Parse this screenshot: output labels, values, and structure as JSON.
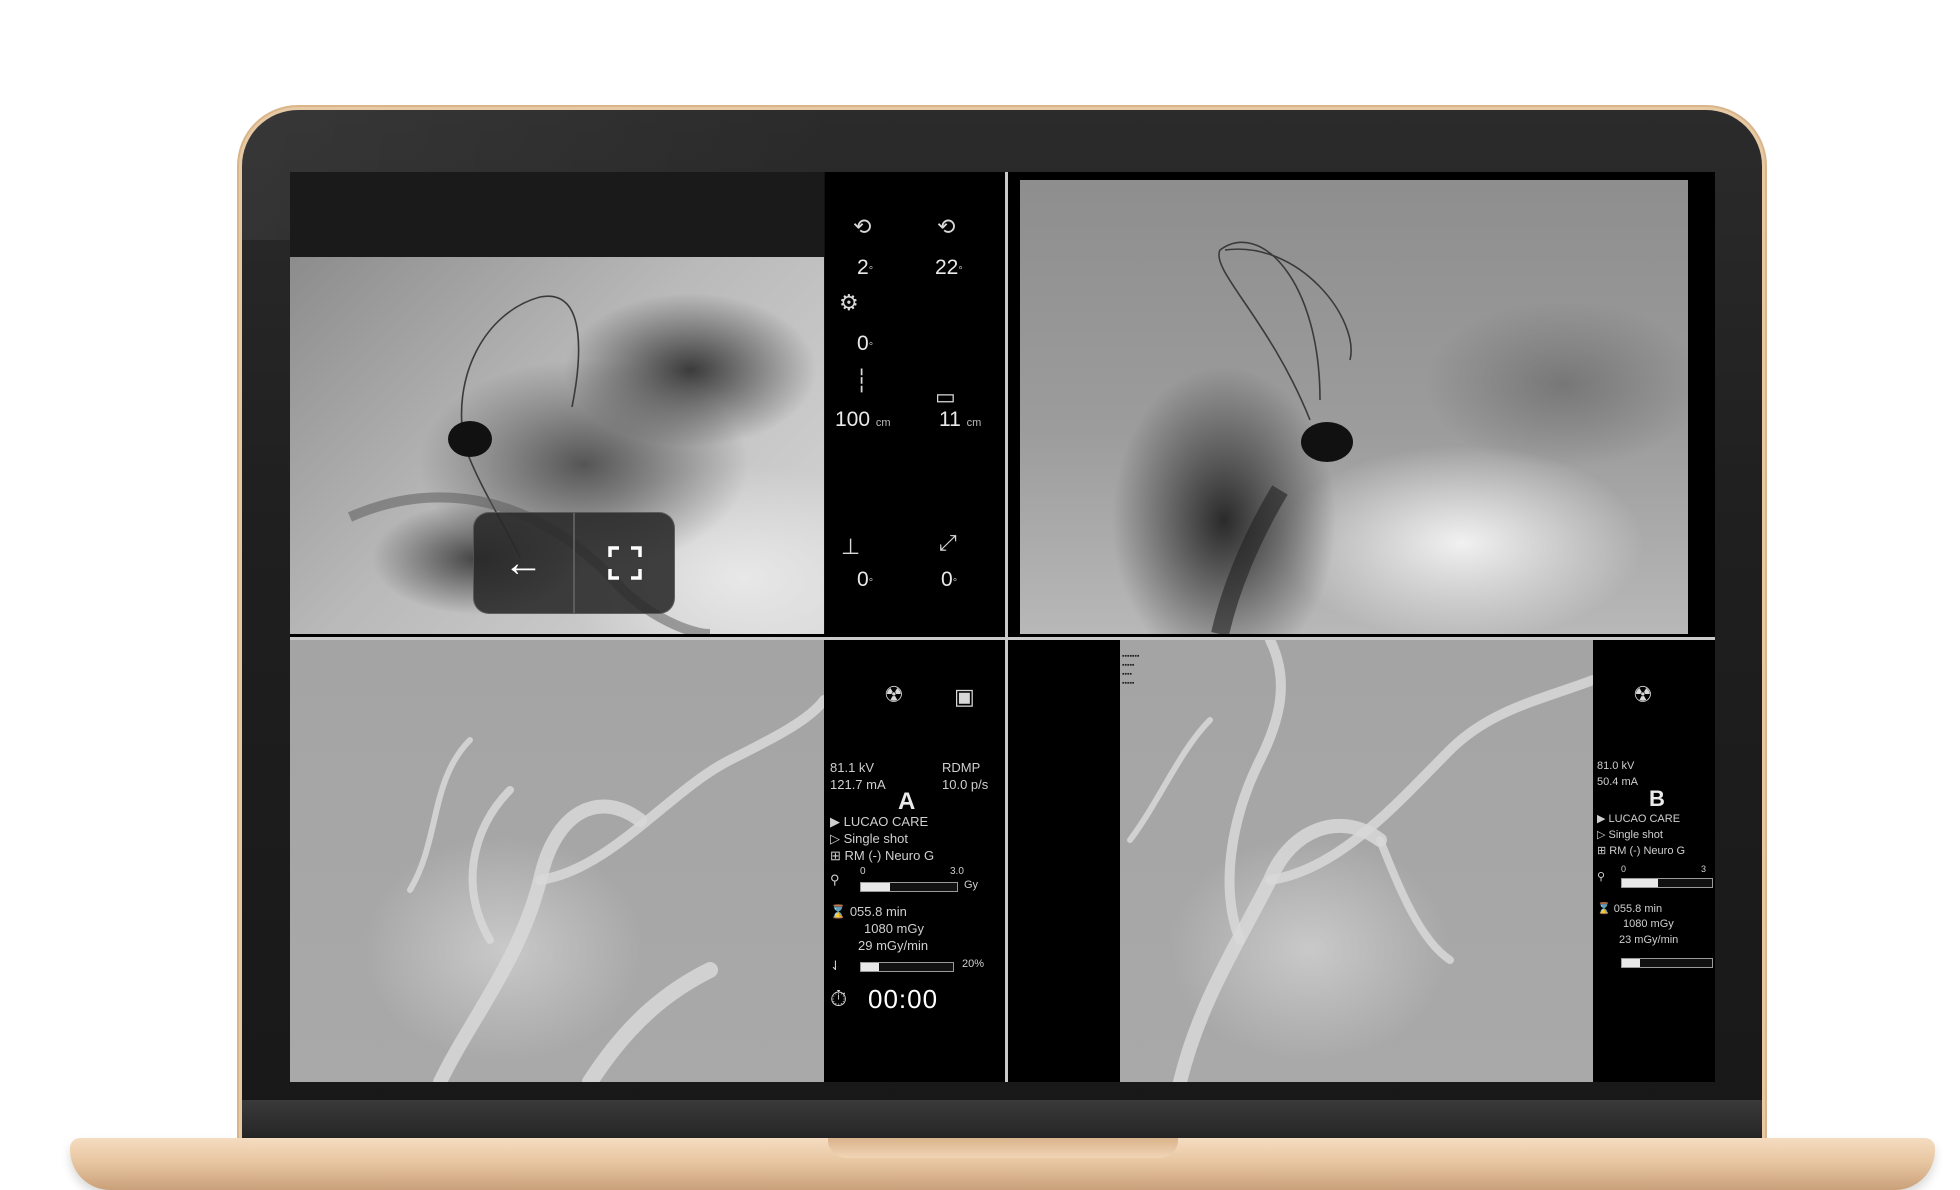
{
  "panels": {
    "a_live": {
      "angles": [
        {
          "value": "2",
          "unit": "°"
        },
        {
          "value": "22",
          "unit": "°"
        },
        {
          "value": "0",
          "unit": "°"
        }
      ],
      "distances": [
        {
          "value": "100",
          "unit": "cm"
        },
        {
          "value": "11",
          "unit": "cm"
        }
      ],
      "table_angles": [
        {
          "value": "0",
          "unit": "°"
        },
        {
          "value": "0",
          "unit": "°"
        }
      ]
    },
    "a_ref": {
      "kv": "81.1 kV",
      "program": "RDMP",
      "ma": "121.7 mA",
      "rate": "10.0 p/s",
      "plane_letter": "A",
      "protocol": "LUCAO CARE",
      "mode": "Single shot",
      "preset": "RM (-) Neuro G",
      "gauge_min": "0",
      "gauge_max": "3.0",
      "gauge_unit": "Gy",
      "gauge_level": 0.3,
      "fluoro_time": "055.8 min",
      "dose": "1080 mGy",
      "dose_rate": "29 mGy/min",
      "percent_level": 0.2,
      "percent_label": "20%",
      "timer": "00:00"
    },
    "b_ref": {
      "kv": "81.0 kV",
      "ma": "50.4 mA",
      "plane_letter": "B",
      "protocol": "LUCAO CARE",
      "mode": "Single shot",
      "preset": "RM (-) Neuro G",
      "gauge_min": "0",
      "gauge_max": "3",
      "gauge_level": 0.4,
      "fluoro_time": "055.8 min",
      "dose": "1080 mGy",
      "dose_rate": "23 mGy/min",
      "percent_level": 0.2
    }
  },
  "nav": {
    "back_icon": "arrow-left-icon",
    "fullscreen_icon": "fullscreen-icon"
  },
  "colors": {
    "active_border": "#c23a3a",
    "bezel": "#1f1f1f",
    "laptop_gold": "#e8c7a2"
  }
}
